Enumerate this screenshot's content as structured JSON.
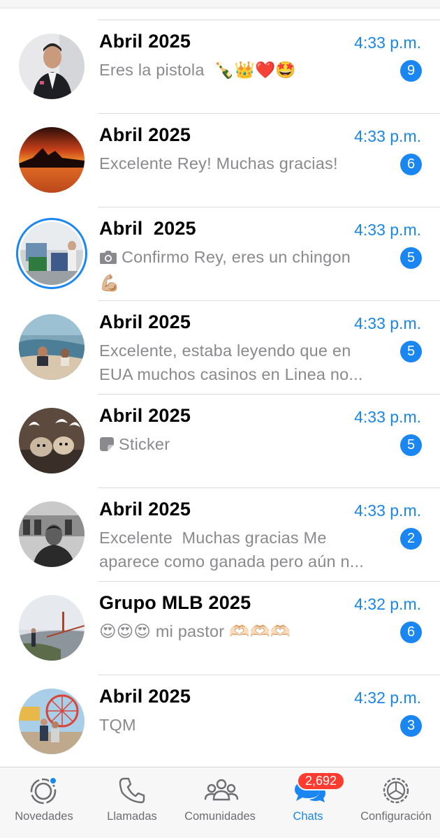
{
  "accent_color": "#1a86f2",
  "chats": [
    {
      "name": "Abril 2025",
      "time": "4:33 p.m.",
      "preview": "Eres la pistola  🍾👑❤️🤩",
      "unread": "9",
      "avatar": "man-in-suit"
    },
    {
      "name": "Abril 2025",
      "time": "4:33 p.m.",
      "preview": "Excelente Rey! Muchas gracias!",
      "unread": "6",
      "avatar": "sunset-lake"
    },
    {
      "name": "Abril  2025",
      "time": "4:33 p.m.",
      "preview": "Confirmo Rey, eres un chingon 💪🏼",
      "preview_icon": "camera-icon",
      "unread": "5",
      "avatar": "indoor-photo",
      "has_status_ring": true
    },
    {
      "name": "Abril 2025",
      "time": "4:33 p.m.",
      "preview": "Excelente, estaba leyendo que en EUA muchos casinos en Linea no...",
      "unread": "5",
      "avatar": "beach"
    },
    {
      "name": "Abril 2025",
      "time": "4:33 p.m.",
      "preview": "Sticker",
      "preview_icon": "sticker-icon",
      "unread": "5",
      "avatar": "dogs-with-wings"
    },
    {
      "name": "Abril 2025",
      "time": "4:33 p.m.",
      "preview": "Excelente  Muchas gracias Me aparece como ganada pero aún n...",
      "unread": "2",
      "avatar": "bw-portrait"
    },
    {
      "name": "Grupo MLB 2025",
      "time": "4:32 p.m.",
      "preview": "😍😍😍 mi pastor 🫶🏻🫶🏻🫶🏻",
      "unread": "6",
      "avatar": "golden-gate-bridge"
    },
    {
      "name": "Abril 2025",
      "time": "4:32 p.m.",
      "preview": "TQM",
      "unread": "3",
      "avatar": "couple-ferris-wheel"
    }
  ],
  "tabbar": {
    "updates": {
      "label": "Novedades",
      "icon": "updates-icon"
    },
    "calls": {
      "label": "Llamadas",
      "icon": "phone-icon"
    },
    "communities": {
      "label": "Comunidades",
      "icon": "communities-icon"
    },
    "chats": {
      "label": "Chats",
      "icon": "chats-icon",
      "badge": "2,692",
      "active": true
    },
    "settings": {
      "label": "Configuración",
      "icon": "gear-icon"
    }
  }
}
